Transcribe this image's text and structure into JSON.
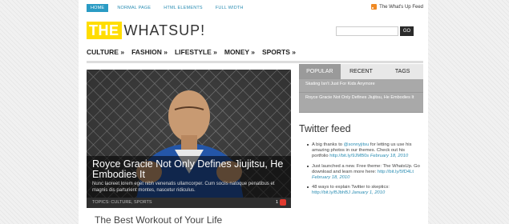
{
  "topnav": {
    "items": [
      "HOME",
      "NORMAL PAGE",
      "HTML ELEMENTS",
      "FULL WIDTH"
    ],
    "feed_label": "The What's Up Feed"
  },
  "logo": {
    "the": "THE",
    "rest": "WHATSUP!"
  },
  "search": {
    "button_label": "GO",
    "value": ""
  },
  "mainnav": [
    "CULTURE »",
    "FASHION »",
    "LIFESTYLE »",
    "MONEY »",
    "SPORTS »"
  ],
  "hero": {
    "title": "Royce Gracie Not Only Defines Jiujitsu, He Embodies It",
    "excerpt": "Nunc laoreet lorem eget nibh venenatis ullamcorper. Cum sociis natoque penatibus et magnis dis parturient montes, nascetur ridiculus.",
    "topics": "TOPICS: CULTURE, SPORTS",
    "comment_count": "1"
  },
  "next_article_title": "The Best Workout of Your Life",
  "tabs": [
    "POPULAR",
    "RECENT",
    "TAGS"
  ],
  "popular_items": [
    "Skating Isn't Just For Kids Anymore",
    "Royce Gracie Not Only Defines Jiujitsu, He Embodies It"
  ],
  "twitter": {
    "title": "Twitter feed",
    "tweets": [
      {
        "pre": "A big thanks to ",
        "handle": "@sonnyjitsu",
        "mid": " for letting us use his amazing photos in our themes. Check out his portfolio ",
        "link": "http://bit.ly/9JMB0s",
        "date": "February 18, 2010"
      },
      {
        "pre": "Just launched a new. Free theme: The WhatsUp. Go download and learn more here: ",
        "handle": "",
        "mid": "",
        "link": "http://bit.ly/5fD4Lt",
        "date": "February 18, 2010"
      },
      {
        "pre": "48 ways to explain Twitter to skeptics: ",
        "handle": "",
        "mid": "",
        "link": "http://bit.ly/BJbhBJ",
        "date": "January 1, 2010"
      }
    ]
  }
}
